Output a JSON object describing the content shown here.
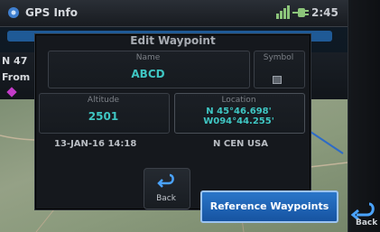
{
  "status_bar": {
    "title": "GPS Info",
    "time": "2:45"
  },
  "background": {
    "row1_text": "N 47",
    "row2_text": "From"
  },
  "modal": {
    "title": "Edit Waypoint",
    "name": {
      "label": "Name",
      "value": "ABCD"
    },
    "symbol": {
      "label": "Symbol"
    },
    "altitude": {
      "label": "Altitude",
      "value": "2501"
    },
    "location": {
      "label": "Location",
      "lat": "N 45°46.698'",
      "lon": "W094°44.255'"
    },
    "datetime": "13-JAN-16 14:18",
    "region": "N CEN USA",
    "back_label": "Back"
  },
  "buttons": {
    "reference_waypoints": "Reference Waypoints",
    "back_softkey": "Back"
  },
  "colors": {
    "accent_cyan": "#3fc6c3",
    "button_blue": "#1f64b5",
    "waypoint_magenta": "#c33bc8"
  }
}
